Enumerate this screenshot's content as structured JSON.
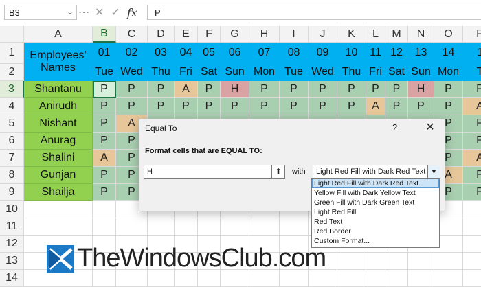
{
  "formula_bar": {
    "name_box": "B3",
    "formula": "P",
    "fx_label": "fx",
    "icons": [
      "dropdown-arrow-icon",
      "cancel-x-icon",
      "enter-check-icon"
    ]
  },
  "columns": [
    "A",
    "B",
    "C",
    "D",
    "E",
    "F",
    "G",
    "H",
    "I",
    "J",
    "K",
    "L",
    "M",
    "N",
    "O",
    "P"
  ],
  "rows": [
    "1",
    "2",
    "3",
    "4",
    "5",
    "6",
    "7",
    "8",
    "9",
    "10",
    "11",
    "12",
    "13",
    "14"
  ],
  "header": {
    "names_title_line1": "Employees'",
    "names_title_line2": "Names",
    "dates": [
      "01",
      "02",
      "03",
      "04",
      "05",
      "06",
      "07",
      "08",
      "09",
      "10",
      "11",
      "12",
      "13",
      "14",
      "1"
    ],
    "days": [
      "Tue",
      "Wed",
      "Thu",
      "Fri",
      "Sat",
      "Sun",
      "Mon",
      "Tue",
      "Wed",
      "Thu",
      "Fri",
      "Sat",
      "Sun",
      "Mon",
      "T"
    ]
  },
  "employees": [
    {
      "name": "Shantanu",
      "att": [
        "P",
        "P",
        "P",
        "A",
        "P",
        "H",
        "P",
        "P",
        "P",
        "P",
        "P",
        "P",
        "H",
        "P",
        "P"
      ]
    },
    {
      "name": "Anirudh",
      "att": [
        "P",
        "P",
        "P",
        "P",
        "P",
        "P",
        "P",
        "P",
        "P",
        "P",
        "A",
        "P",
        "P",
        "P",
        "A"
      ]
    },
    {
      "name": "Nishant",
      "att": [
        "P",
        "A",
        "",
        "",
        "",
        "",
        "",
        "",
        "",
        "",
        "",
        "",
        "",
        "P",
        "P"
      ]
    },
    {
      "name": "Anurag",
      "att": [
        "P",
        "P",
        "",
        "",
        "",
        "",
        "",
        "",
        "",
        "",
        "",
        "",
        "",
        "P",
        "P"
      ]
    },
    {
      "name": "Shalini",
      "att": [
        "A",
        "P",
        "",
        "",
        "",
        "",
        "",
        "",
        "",
        "",
        "",
        "",
        "",
        "P",
        "A"
      ]
    },
    {
      "name": "Gunjan",
      "att": [
        "P",
        "P",
        "",
        "",
        "",
        "",
        "",
        "",
        "",
        "",
        "",
        "",
        "",
        "A",
        "P"
      ]
    },
    {
      "name": "Shailja",
      "att": [
        "P",
        "P",
        "",
        "",
        "",
        "",
        "",
        "",
        "",
        "",
        "",
        "",
        "",
        "P",
        "P"
      ]
    }
  ],
  "dialog": {
    "title": "Equal To",
    "help": "?",
    "close": "✕",
    "label": "Format cells that are EQUAL TO:",
    "value": "H",
    "with_label": "with",
    "selected_format": "Light Red Fill with Dark Red Text",
    "options": [
      "Light Red Fill with Dark Red Text",
      "Yellow Fill with Dark Yellow Text",
      "Green Fill with Dark Green Text",
      "Light Red Fill",
      "Red Text",
      "Red Border",
      "Custom Format..."
    ]
  },
  "watermark": {
    "text": "TheWindowsClub.com"
  },
  "colors": {
    "header_blue": "#00b0f0",
    "name_green": "#92d050",
    "present": "#a9cfb1",
    "absent": "#e7c79a",
    "holiday": "#d9a3a3"
  }
}
